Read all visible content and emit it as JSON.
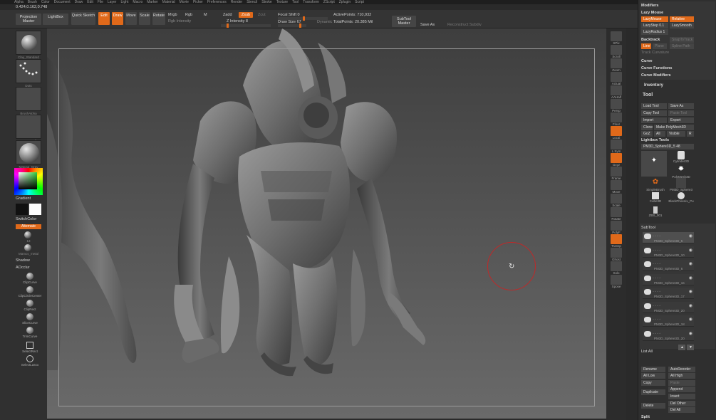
{
  "menu": [
    "Alpha",
    "Brush",
    "Color",
    "Document",
    "Draw",
    "Edit",
    "File",
    "Layer",
    "Light",
    "Macro",
    "Marker",
    "Material",
    "Movie",
    "Picker",
    "Preferences",
    "Render",
    "Stencil",
    "Stroke",
    "Texture",
    "Tool",
    "Transform",
    "ZScript",
    "Zplugin",
    "Script"
  ],
  "coords": "0.424,0.162,0.748",
  "toolbar": {
    "projection_master": "Projection Master",
    "lightbox": "LightBox",
    "quick_sketch": "Quick Sketch",
    "edit": "Edit",
    "draw": "Draw",
    "move": "Move",
    "scale": "Scale",
    "rotate": "Rotate",
    "mrgb": "Mrgb",
    "rgb": "Rgb",
    "m": "M",
    "rgb_intensity": "Rgb Intensity",
    "zadd": "Zadd",
    "zsub": "Zsub",
    "zcut": "Zcut",
    "z_intensity": "Z Intensity 8",
    "focal_shift": "Focal Shift 0",
    "draw_size": "Draw Size 67",
    "dynamic": "Dynamic",
    "active_points": "ActivePoints: 710,932",
    "total_points": "TotalPoints: 20.385 Mil",
    "subtool_master": "SubTool Master",
    "save_as": "Save As",
    "reconstruct_subdiv": "Reconstruct Subdiv"
  },
  "leftshelf": {
    "brush_label": "Clay_Standard",
    "stroke_label": "Dots",
    "alpha_label": "BrushAlpha",
    "texture_label": "Texture Off",
    "material_label": "Matcap_Gray",
    "gradient": "Gradient",
    "switchcolor": "SwitchColor",
    "alternate": "Alternate",
    "mat1": "13",
    "mat2": "Mamcs_metal",
    "shadow": "Shadow",
    "aoccluc": "AOcclur",
    "tools": [
      "ClipCurve",
      "ClipCircleCenter",
      "ClipRect",
      "SliceCurve",
      "TrimCurve",
      "SelectRect",
      "SelectLasso"
    ]
  },
  "rstrip": [
    "SPix",
    "Scroll",
    "Zoom",
    "Actual",
    "AAHalf",
    "Persp",
    "Floor",
    "Local",
    "L.Sym",
    "Gxyz",
    "Frame",
    "Move",
    "Scale",
    "Rotate",
    "PolyF",
    "Transp",
    "Ghost",
    "Solo",
    "Xpose"
  ],
  "rpanel": {
    "modifiers": "Modifiers",
    "lazy_mouse": "Lazy Mouse",
    "lazymouse_btn": "LazyMouse",
    "relative": "Relative",
    "lazystep": "LazyStep 0.1",
    "lazysmooth": "LazySmooth",
    "lazyradius": "LazyRadius 1",
    "backtrack": "Backtrack",
    "snaptotrack": "SnapToTrack",
    "line": "Line",
    "plane": "Plane",
    "spline_path": "Spline Path",
    "track_curvature": "Track Curvature",
    "curve": "Curve",
    "curve_functions": "Curve Functions",
    "curve_modifiers": "Curve Modifiers",
    "inventory": "Inventory",
    "tool": "Tool",
    "load_tool": "Load Tool",
    "save_as": "Save As",
    "copy_tool": "Copy Tool",
    "paste_tool": "Paste Tool",
    "import": "Import",
    "export": "Export",
    "clone": "Clone",
    "make_polymesh": "Make PolyMesh3D",
    "goz": "GoZ",
    "all": "All",
    "visible": "Visible",
    "r": "R",
    "lightbox_tools": "Lightbox Tools",
    "current_tool": "PM3D_Sphere3D_5 48",
    "tool_thumbs": [
      "",
      "Cylinder3D",
      "",
      "PolyMesh3D",
      "SimpleBrush",
      "PM3D_Sphere3",
      "Cube3D",
      "BlackPhoenix_Pu",
      "ZBS_001"
    ],
    "subtool": "SubTool",
    "subtools": [
      "PM3D_Sphere3D_5",
      "PM3D_Sphere3D_10",
      "PM3D_Sphere3D_6",
      "PM3D_Sphere3D_16",
      "PM3D_Sphere3D_17",
      "PM3D_Sphere3D_20",
      "PM3D_Sphere3D_18",
      "PM3D_Sphere3D_20"
    ],
    "list_all": "List All",
    "rename": "Rename",
    "autoreorder": "AutoReorder",
    "all_low": "All Low",
    "all_high": "All High",
    "copy": "Copy",
    "paste": "Paste",
    "duplicate": "Duplicate",
    "append": "Append",
    "insert": "Insert",
    "delete": "Delete",
    "del_other": "Del Other",
    "del_all": "Del All",
    "split": "Split"
  },
  "colors": {
    "accent": "#e0691a",
    "cursor": "#c02828"
  }
}
